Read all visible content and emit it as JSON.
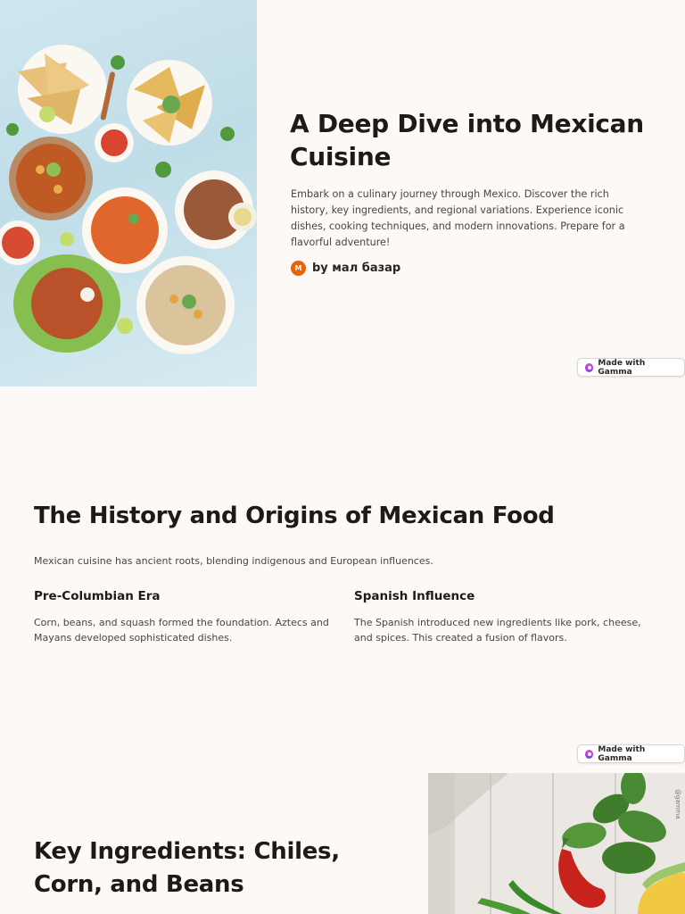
{
  "slide1": {
    "title": "A Deep Dive into Mexican Cuisine",
    "lead": "Embark on a culinary journey through Mexico. Discover the rich history, key ingredients, and regional variations. Experience iconic dishes, cooking techniques, and modern innovations. Prepare for a flavorful adventure!",
    "author_initial": "M",
    "author_text": "by мал базар",
    "badge": "Made with Gamma"
  },
  "slide2": {
    "title": "The History and Origins of Mexican Food",
    "intro": "Mexican cuisine has ancient roots, blending indigenous and European influences.",
    "columns": [
      {
        "heading": "Pre-Columbian Era",
        "body": "Corn, beans, and squash formed the foundation. Aztecs and Mayans developed sophisticated dishes."
      },
      {
        "heading": "Spanish Influence",
        "body": "The Spanish introduced new ingredients like pork, cheese, and spices. This created a fusion of flavors."
      }
    ],
    "badge": "Made with Gamma"
  },
  "slide3": {
    "title": "Key Ingredients: Chiles, Corn, and Beans",
    "watermark": "@gamma"
  },
  "colors": {
    "page_background": "#fdf9f7",
    "heading": "#1d1a1a",
    "body_text": "#4a4444",
    "author_avatar": "#e8630a",
    "gamma_accent": "#b44ae0"
  },
  "icons": [
    "gamma-logo-icon",
    "author-avatar"
  ]
}
